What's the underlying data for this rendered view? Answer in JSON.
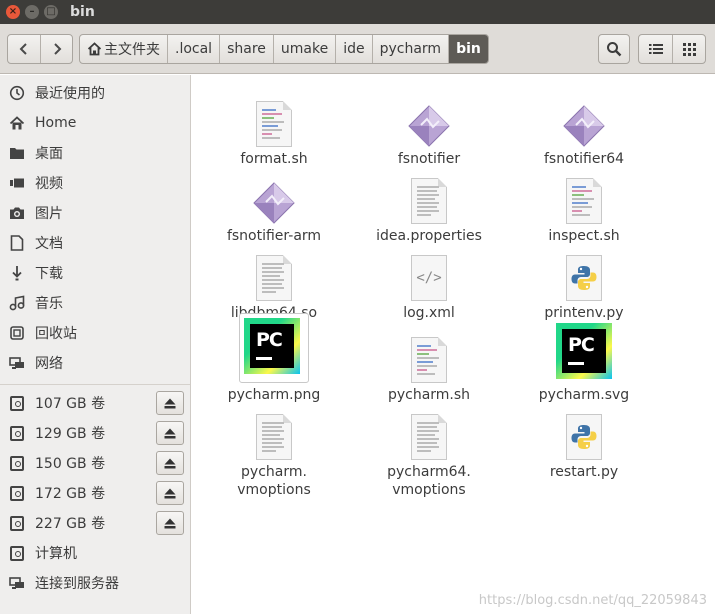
{
  "window": {
    "title": "bin"
  },
  "breadcrumbs": [
    {
      "label": "主文件夹",
      "icon": "home-icon"
    },
    {
      "label": ".local"
    },
    {
      "label": "share"
    },
    {
      "label": "umake"
    },
    {
      "label": "ide"
    },
    {
      "label": "pycharm"
    },
    {
      "label": "bin",
      "active": true
    }
  ],
  "sidebar": {
    "places": [
      {
        "label": "最近使用的",
        "icon": "recent-icon"
      },
      {
        "label": "Home",
        "icon": "home-icon"
      },
      {
        "label": "桌面",
        "icon": "folder-icon"
      },
      {
        "label": "视频",
        "icon": "video-icon"
      },
      {
        "label": "图片",
        "icon": "camera-icon"
      },
      {
        "label": "文档",
        "icon": "document-icon"
      },
      {
        "label": "下载",
        "icon": "download-icon"
      },
      {
        "label": "音乐",
        "icon": "music-icon"
      },
      {
        "label": "回收站",
        "icon": "trash-icon"
      },
      {
        "label": "网络",
        "icon": "network-icon"
      }
    ],
    "devices": [
      {
        "label": "107 GB 卷"
      },
      {
        "label": "129 GB 卷"
      },
      {
        "label": "150 GB 卷"
      },
      {
        "label": "172 GB 卷"
      },
      {
        "label": "227 GB 卷"
      }
    ],
    "other": [
      {
        "label": "计算机",
        "icon": "computer-icon"
      },
      {
        "label": "连接到服务器",
        "icon": "server-icon"
      }
    ]
  },
  "files": [
    {
      "name": "format.sh",
      "type": "script"
    },
    {
      "name": "fsnotifier",
      "type": "executable"
    },
    {
      "name": "fsnotifier64",
      "type": "executable"
    },
    {
      "name": "fsnotifier-arm",
      "type": "executable"
    },
    {
      "name": "idea.properties",
      "type": "text"
    },
    {
      "name": "inspect.sh",
      "type": "script"
    },
    {
      "name": "libdbm64.so",
      "type": "text"
    },
    {
      "name": "log.xml",
      "type": "xml"
    },
    {
      "name": "printenv.py",
      "type": "python"
    },
    {
      "name": "pycharm.png",
      "type": "pycharm-image"
    },
    {
      "name": "pycharm.sh",
      "type": "script"
    },
    {
      "name": "pycharm.svg",
      "type": "pycharm-image"
    },
    {
      "name": "pycharm.\nvmoptions",
      "type": "text"
    },
    {
      "name": "pycharm64.\nvmoptions",
      "type": "text"
    },
    {
      "name": "restart.py",
      "type": "python"
    }
  ],
  "pycharm_icon_text": "PC",
  "watermark": "https://blog.csdn.net/qq_22059843"
}
